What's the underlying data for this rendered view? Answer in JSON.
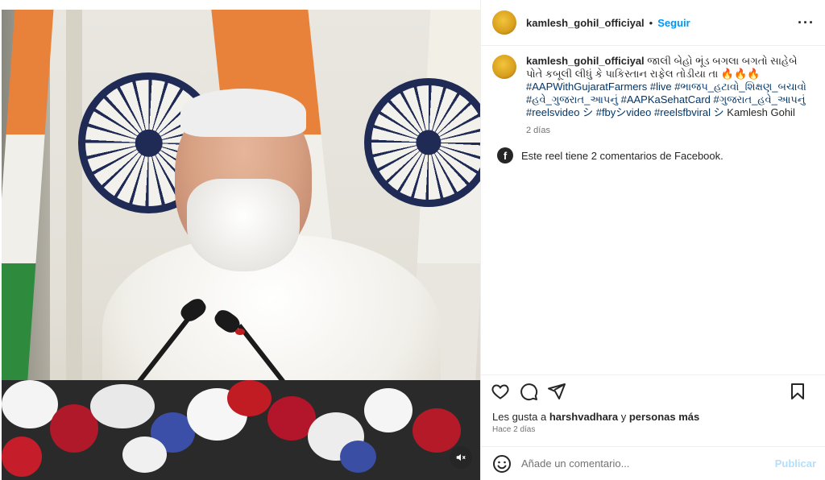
{
  "media": {
    "mute_icon": "muted-speaker-icon"
  },
  "header": {
    "username": "kamlesh_gohil_officiyal",
    "separator": "•",
    "follow_label": "Seguir",
    "more_icon": "more-options-icon",
    "more_glyph": "···"
  },
  "caption": {
    "username": "kamlesh_gohil_officiyal",
    "text": "જાલી બેહો ભૂંડ બગલા બગતો સાહેબે પોતે કબૂલી લીધું કે પાકિસ્તાન રાફેલ તોડીયા તા 🔥🔥🔥",
    "hashtags": "#AAPWithGujaratFarmers #live #ભાજપ_હટાવો_શિક્ષણ_બચાવો #હવે_ગુજરાત_આપનું #AAPKaSehatCard #ગુજરાત_હવે_આપનું #reelsvideo シ #fbyシvideo #reelsfbviral シ",
    "mention": "Kamlesh Gohil",
    "time": "2 días"
  },
  "facebook_note": {
    "icon": "facebook-icon",
    "icon_glyph": "f",
    "text": "Este reel tiene 2 comentarios de Facebook."
  },
  "actions": {
    "like_icon": "heart-icon",
    "comment_icon": "comment-icon",
    "share_icon": "share-icon",
    "save_icon": "bookmark-icon"
  },
  "likes": {
    "prefix": "Les gusta a ",
    "user": "harshvadhara",
    "middle": " y ",
    "others": "personas más"
  },
  "ago": "Hace 2 días",
  "comment": {
    "emoji_icon": "emoji-icon",
    "placeholder": "Añade un comentario...",
    "publish_label": "Publicar"
  },
  "colors": {
    "accent": "#0095f6",
    "hashtag": "#00376b",
    "publish_disabled": "#b2dffc",
    "muted_text": "#737373"
  }
}
